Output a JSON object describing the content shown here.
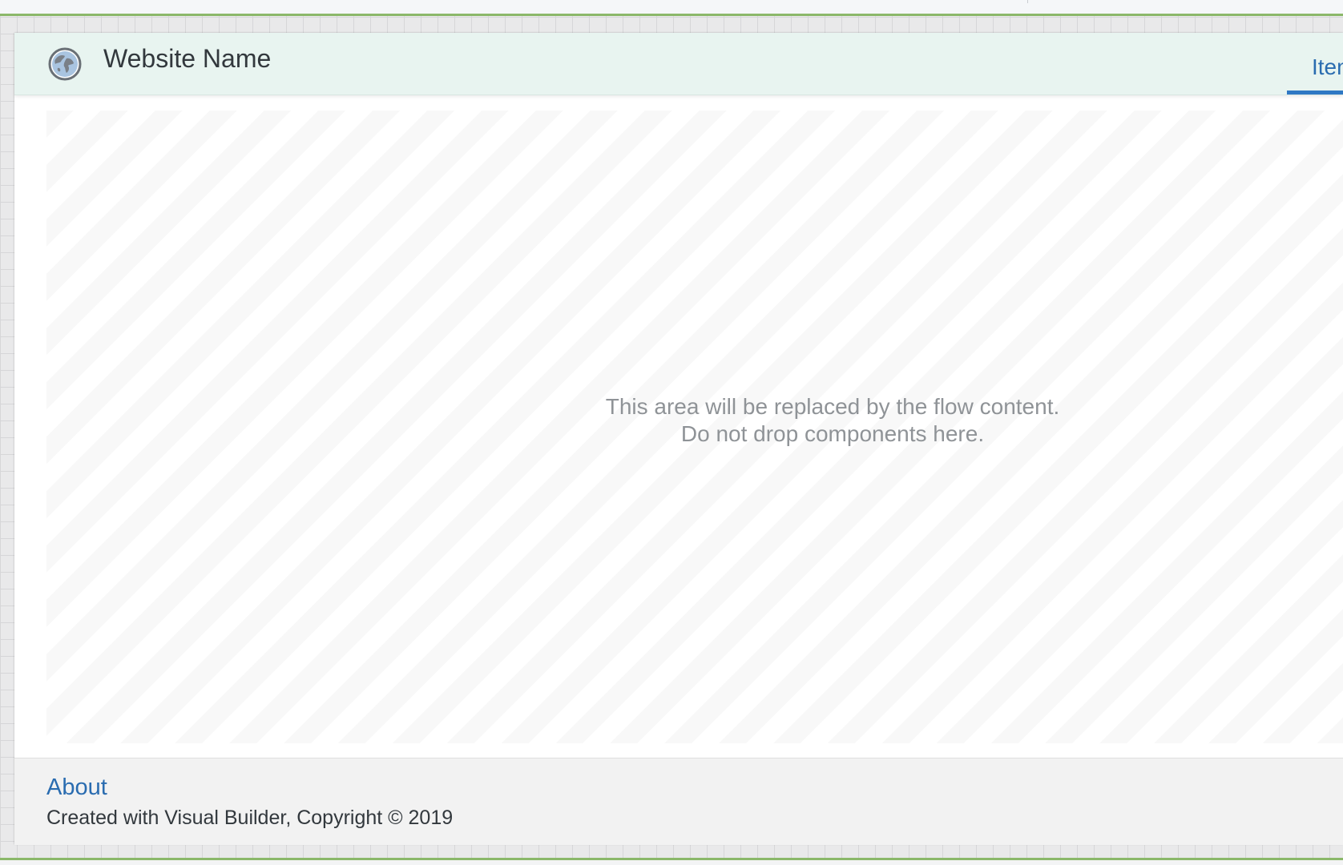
{
  "site": {
    "name": "Website Name",
    "logo_icon": "globe-icon"
  },
  "nav": {
    "tabs": [
      {
        "label": "Item",
        "active": true
      }
    ]
  },
  "flow_area": {
    "line1": "This area will be replaced by the flow content.",
    "line2": "Do not drop components here."
  },
  "footer": {
    "link_label": "About",
    "copyright": "Created with Visual Builder, Copyright © 2019"
  },
  "colors": {
    "header_bg": "#e8f4f0",
    "accent": "#2f78c4",
    "link": "#2a6cb0",
    "frame_green": "#8bb86a",
    "footer_bg": "#f2f2f2"
  }
}
